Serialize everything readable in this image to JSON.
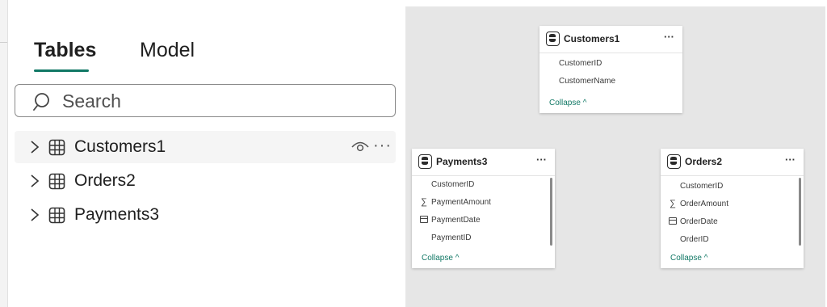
{
  "fields_pane": {
    "tabs": [
      {
        "label": "Tables",
        "active": true
      },
      {
        "label": "Model",
        "active": false
      }
    ],
    "search": {
      "placeholder": "Search",
      "value": ""
    },
    "tables": [
      {
        "name": "Customers1",
        "hovered": true,
        "icon": "table-grid-icon"
      },
      {
        "name": "Orders2",
        "hovered": false,
        "icon": "table-grid-icon"
      },
      {
        "name": "Payments3",
        "hovered": false,
        "icon": "table-grid-icon"
      }
    ],
    "row_actions": {
      "more": "···"
    }
  },
  "model_canvas": {
    "cards": {
      "customers": {
        "title": "Customers1",
        "more": "···",
        "fields": [
          {
            "name": "CustomerID",
            "icon": "none"
          },
          {
            "name": "CustomerName",
            "icon": "none"
          }
        ],
        "collapse": "Collapse ^"
      },
      "payments": {
        "title": "Payments3",
        "more": "···",
        "fields": [
          {
            "name": "CustomerID",
            "icon": "none"
          },
          {
            "name": "PaymentAmount",
            "icon": "sigma-icon"
          },
          {
            "name": "PaymentDate",
            "icon": "calendar-icon"
          },
          {
            "name": "PaymentID",
            "icon": "none"
          }
        ],
        "collapse": "Collapse ^"
      },
      "orders": {
        "title": "Orders2",
        "more": "···",
        "fields": [
          {
            "name": "CustomerID",
            "icon": "none"
          },
          {
            "name": "OrderAmount",
            "icon": "sigma-icon"
          },
          {
            "name": "OrderDate",
            "icon": "calendar-icon"
          },
          {
            "name": "OrderID",
            "icon": "none"
          }
        ],
        "collapse": "Collapse ^"
      }
    },
    "sigma_glyph": "∑"
  },
  "colors": {
    "accent": "#117865",
    "canvas_bg": "#e6e6e6",
    "text": "#1f1f1f"
  }
}
